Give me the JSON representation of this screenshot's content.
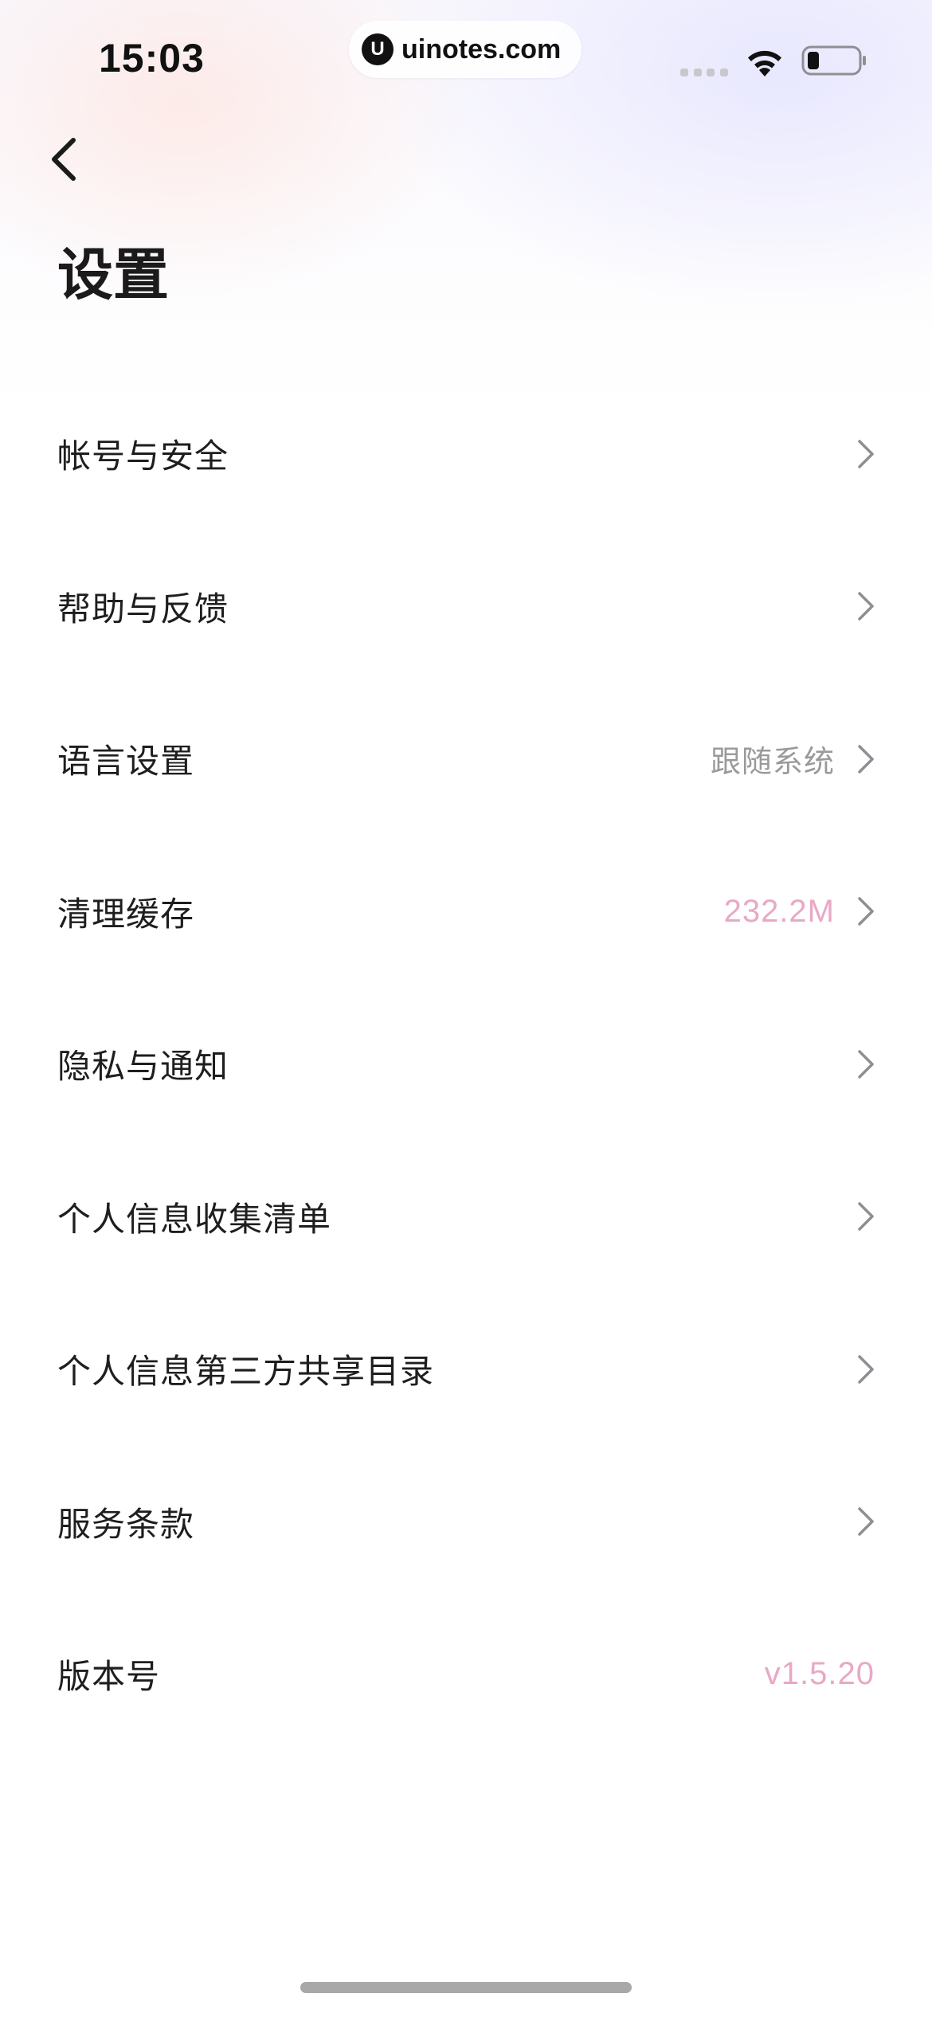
{
  "status_bar": {
    "time": "15:03",
    "watermark_logo": "U",
    "watermark_text": "uinotes.com",
    "icons": [
      "signal-icon",
      "wifi-icon",
      "battery-icon"
    ]
  },
  "header": {
    "back_icon": "chevron-left-icon",
    "title": "设置"
  },
  "settings": [
    {
      "label": "帐号与安全",
      "value": "",
      "chevron": true
    },
    {
      "label": "帮助与反馈",
      "value": "",
      "chevron": true
    },
    {
      "label": "语言设置",
      "value": "跟随系统",
      "value_style": "gray",
      "chevron": true
    },
    {
      "label": "清理缓存",
      "value": "232.2M",
      "value_style": "pink",
      "chevron": true
    },
    {
      "label": "隐私与通知",
      "value": "",
      "chevron": true
    },
    {
      "label": "个人信息收集清单",
      "value": "",
      "chevron": true
    },
    {
      "label": "个人信息第三方共享目录",
      "value": "",
      "chevron": true
    },
    {
      "label": "服务条款",
      "value": "",
      "chevron": true
    },
    {
      "label": "版本号",
      "value": "v1.5.20",
      "value_style": "pink",
      "chevron": false
    }
  ],
  "colors": {
    "accent_pink": "#e9a8c6",
    "secondary_gray": "#9a9a9a",
    "chevron_gray": "#8e8e93",
    "text_primary": "#1e1e1e"
  }
}
